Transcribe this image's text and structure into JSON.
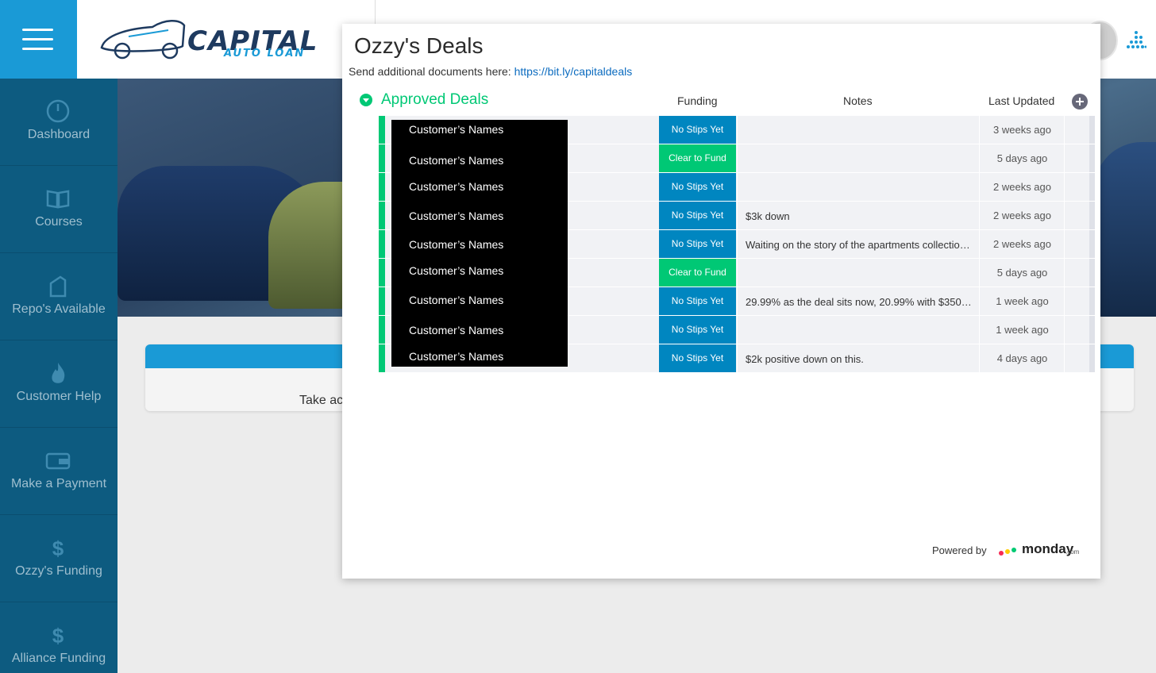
{
  "brand": {
    "logo_main": "CAPITAL",
    "logo_sub": "AUTO LOAN"
  },
  "sidebar": {
    "items": [
      {
        "label": "Dashboard",
        "icon": "gauge-icon"
      },
      {
        "label": "Courses",
        "icon": "book-icon"
      },
      {
        "label": "Repo's Available",
        "icon": "lock-icon"
      },
      {
        "label": "Customer Help",
        "icon": "flame-icon"
      },
      {
        "label": "Make a Payment",
        "icon": "wallet-icon"
      },
      {
        "label": "Ozzy's Funding",
        "icon": "dollar-icon"
      },
      {
        "label": "Alliance Funding",
        "icon": "dollar-icon"
      }
    ]
  },
  "card": {
    "text": "Take ac"
  },
  "modal": {
    "title": "Ozzy's Deals",
    "subtitle_prefix": "Send additional documents here: ",
    "link_text": "https://bit.ly/capitaldeals",
    "group_title": "Approved Deals",
    "columns": {
      "funding": "Funding",
      "notes": "Notes",
      "last_updated": "Last Updated"
    },
    "rows": [
      {
        "name": "Customer’s Names",
        "status": "No Stips Yet",
        "status_color": "#0086c0",
        "note": "",
        "updated": "3 weeks ago"
      },
      {
        "name": "Customer’s Names",
        "status": "Clear to Fund",
        "status_color": "#00c875",
        "note": "",
        "updated": "5 days ago"
      },
      {
        "name": "Customer’s Names",
        "status": "No Stips Yet",
        "status_color": "#0086c0",
        "note": "",
        "updated": "2 weeks ago"
      },
      {
        "name": "Customer’s Names",
        "status": "No Stips Yet",
        "status_color": "#0086c0",
        "note": "$3k down",
        "updated": "2 weeks ago"
      },
      {
        "name": "Customer’s Names",
        "status": "No Stips Yet",
        "status_color": "#0086c0",
        "note": "Waiting on the story of the apartments collectio…",
        "updated": "2 weeks ago"
      },
      {
        "name": "Customer’s Names",
        "status": "Clear to Fund",
        "status_color": "#00c875",
        "note": "",
        "updated": "5 days ago"
      },
      {
        "name": "Customer’s Names",
        "status": "No Stips Yet",
        "status_color": "#0086c0",
        "note": "29.99% as the deal sits now, 20.99% with $350…",
        "updated": "1 week ago"
      },
      {
        "name": "Customer’s Names",
        "status": "No Stips Yet",
        "status_color": "#0086c0",
        "note": "",
        "updated": "1 week ago"
      },
      {
        "name": "Customer’s Names",
        "status": "No Stips Yet",
        "status_color": "#0086c0",
        "note": "$2k positive down on this.",
        "updated": "4 days ago"
      }
    ],
    "footer": {
      "powered_by": "Powered by",
      "brand": "monday",
      "brand_suffix": ".com"
    }
  },
  "colors": {
    "accent": "#1a9ad6",
    "sidebar": "#0d5b80",
    "approved_green": "#00c875",
    "status_blue": "#0086c0"
  }
}
